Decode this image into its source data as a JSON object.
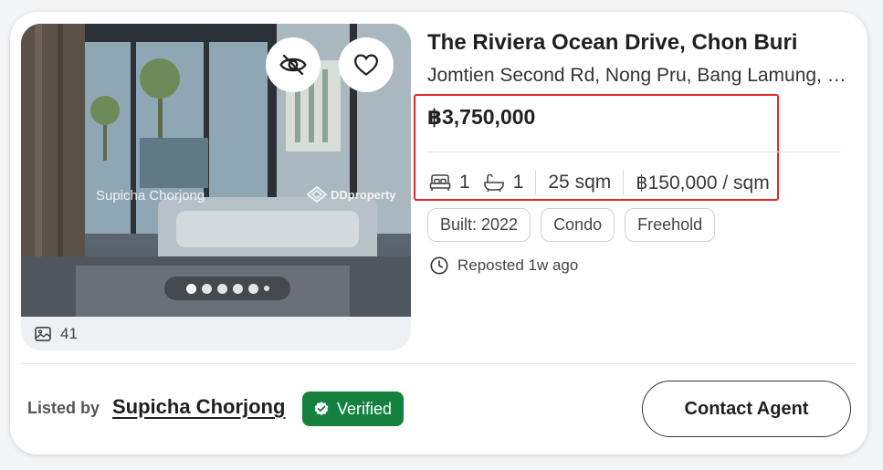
{
  "listing": {
    "title": "The Riviera Ocean Drive, Chon Buri",
    "address": "Jomtien Second Rd, Nong Pru, Bang Lamung, Chon Buri",
    "price": "฿3,750,000",
    "specs": {
      "bedrooms": "1",
      "bathrooms": "1",
      "area": "25 sqm",
      "price_per_sqm": "฿150,000 / sqm"
    },
    "tags": [
      "Built: 2022",
      "Condo",
      "Freehold"
    ],
    "reposted": "Reposted 1w ago"
  },
  "media": {
    "watermark_name": "Supicha Chorjong",
    "watermark_brand": "DDproperty",
    "photo_count": "41",
    "carousel_dots": 6,
    "active_dot": 0
  },
  "agent": {
    "listed_by_label": "Listed by",
    "name": "Supicha Chorjong",
    "verified_label": "Verified",
    "contact_label": "Contact Agent"
  },
  "icons": {
    "hide": "eye-off-icon",
    "favorite": "heart-icon",
    "photos": "gallery-icon",
    "bed": "bed-icon",
    "bath": "bathtub-icon",
    "clock": "clock-icon",
    "verified": "verified-badge-icon"
  },
  "colors": {
    "verified_bg": "#14813e",
    "highlight": "#e12727"
  }
}
